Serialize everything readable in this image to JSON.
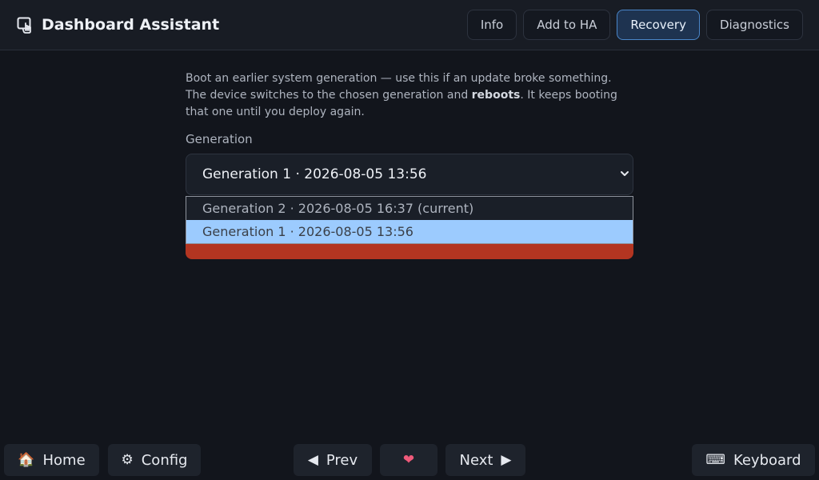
{
  "header": {
    "title": "Dashboard Assistant",
    "icon": "touch-screen-icon",
    "tabs": [
      "Info",
      "Add to HA",
      "Recovery",
      "Diagnostics"
    ],
    "active_tab": "Recovery"
  },
  "recovery": {
    "desc_part1": "Boot an earlier system generation — use this if an update broke something. The device switches to the chosen generation and ",
    "desc_bold": "reboots",
    "desc_part2": ". It keeps booting that one until you deploy again.",
    "field_label": "Generation",
    "selected_value": "Generation 1 · 2026-08-05 13:56",
    "options": [
      "Generation 2 · 2026-08-05 16:37 (current)",
      "Generation 1 · 2026-08-05 13:56"
    ],
    "selected_index": 1,
    "action_color": "#b33521"
  },
  "footer": {
    "home": {
      "icon": "🏠",
      "label": "Home"
    },
    "config": {
      "icon": "⚙",
      "label": "Config"
    },
    "prev": {
      "icon": "◀",
      "label": "Prev"
    },
    "heart": {
      "icon": "❤"
    },
    "next": {
      "label": "Next",
      "icon": "▶"
    },
    "keyboard": {
      "icon": "⌨",
      "label": "Keyboard"
    }
  }
}
